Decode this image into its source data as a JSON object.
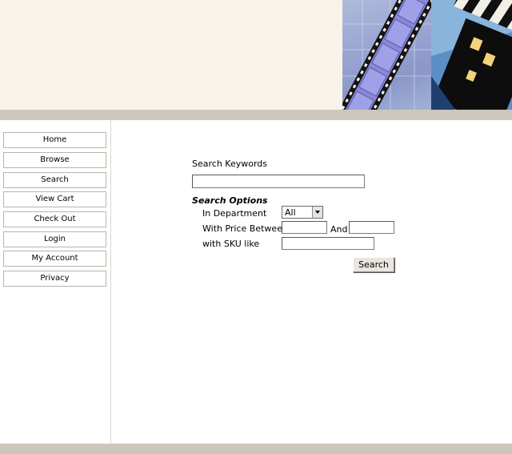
{
  "nav": {
    "items": [
      {
        "label": "Home"
      },
      {
        "label": "Browse"
      },
      {
        "label": "Search"
      },
      {
        "label": "View Cart"
      },
      {
        "label": "Check Out"
      },
      {
        "label": "Login"
      },
      {
        "label": "My Account"
      },
      {
        "label": "Privacy"
      }
    ]
  },
  "search": {
    "keywords_label": "Search Keywords",
    "keywords_value": "",
    "options_heading": "Search Options",
    "department_label": "In Department",
    "department_selected": "All",
    "price_label": "With Price Between",
    "price_and": "And",
    "price_min": "",
    "price_max": "",
    "sku_label": "with SKU like",
    "sku_value": "",
    "button_label": "Search"
  },
  "colors": {
    "header_bg": "#f7f3e8",
    "band": "#cdc6bd"
  },
  "icons": {
    "film_strip": "film-strip-banner",
    "clapperboard": "clapperboard-banner"
  }
}
